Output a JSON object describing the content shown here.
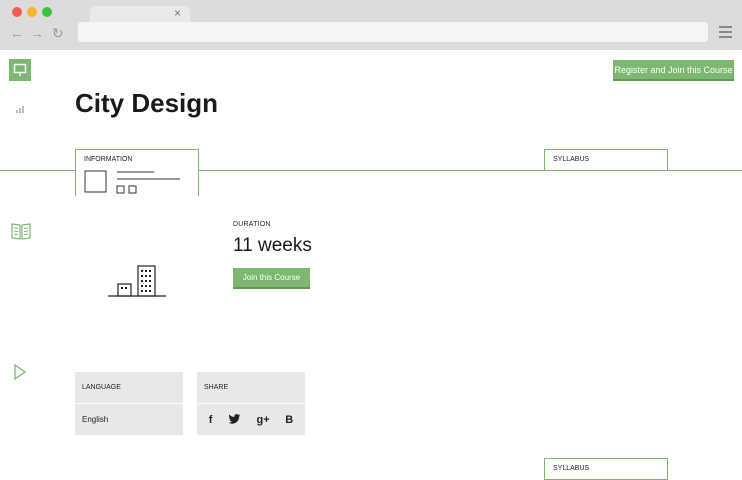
{
  "browser": {
    "back_glyph": "←",
    "forward_glyph": "→",
    "reload_glyph": "↻",
    "close_glyph": "×"
  },
  "header": {
    "register_label": "Register and Join this Course",
    "title": "City Design"
  },
  "tabs": {
    "information_label": "INFORMATION",
    "syllabus_label": "SYLLABUS"
  },
  "duration": {
    "label": "DURATION",
    "value": "11 weeks",
    "join_label": "Join this Course"
  },
  "language": {
    "label": "LANGUAGE",
    "value": "English"
  },
  "share": {
    "label": "SHARE",
    "icons": [
      "facebook-icon",
      "twitter-icon",
      "google-plus-icon",
      "behance-icon"
    ],
    "facebook_glyph": "f",
    "gplus_glyph": "g+",
    "behance_glyph": "B"
  },
  "colors": {
    "accent": "#7cb86f",
    "panel": "#e8e8e8"
  }
}
